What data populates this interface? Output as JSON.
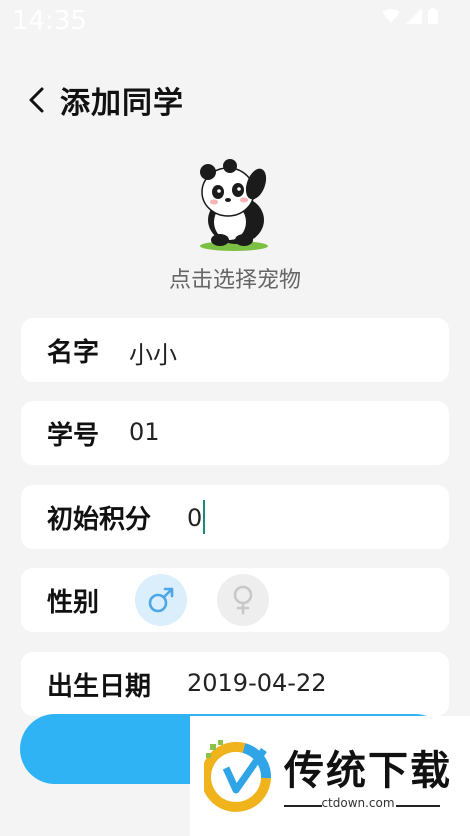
{
  "status_bar": {
    "time": "14:35"
  },
  "header": {
    "title": "添加同学"
  },
  "pet": {
    "label": "点击选择宠物"
  },
  "form": {
    "name": {
      "label": "名字",
      "value": "小小"
    },
    "student_id": {
      "label": "学号",
      "value": "01"
    },
    "initial_score": {
      "label": "初始积分",
      "value": "0"
    },
    "gender": {
      "label": "性别",
      "selected": "male",
      "male_symbol": "♂",
      "female_symbol": "♀"
    },
    "birthday": {
      "label": "出生日期",
      "value": "2019-04-22"
    }
  },
  "watermark": {
    "title": "传统下载",
    "site": "ctdown.com"
  },
  "colors": {
    "accent": "#2fb3f5",
    "male_icon": "#4da6e6",
    "female_icon": "#cccccc",
    "background": "#f4f4f4"
  },
  "icons": [
    "back-arrow-icon",
    "wifi-icon",
    "signal-icon",
    "battery-icon",
    "male-icon",
    "female-icon"
  ]
}
